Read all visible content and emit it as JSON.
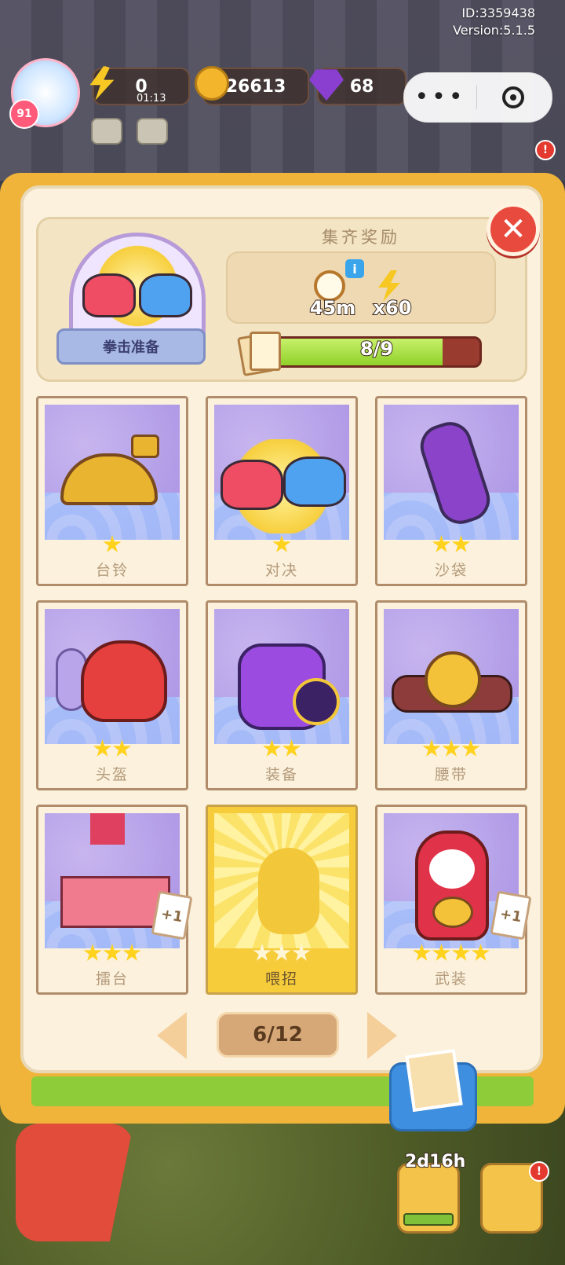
{
  "system": {
    "id_label": "ID:3359438",
    "version_label": "Version:5.1.5"
  },
  "hud": {
    "level": "91",
    "energy": "0",
    "energy_timer": "01:13",
    "coins": "26613",
    "gems": "68",
    "icons": [
      "settings-icon",
      "mail-icon"
    ]
  },
  "capsule": {
    "more_label": "•••",
    "close_icon": "record-icon"
  },
  "album": {
    "set_name": "拳击准备",
    "reward_title": "集齐奖励",
    "rewards": [
      {
        "icon": "clock-icon",
        "value": "45m"
      },
      {
        "icon": "lightning-icon",
        "value": "x60"
      }
    ],
    "progress_label": "8/9",
    "progress_fraction": 0.82,
    "close_icon": "close-icon",
    "info_label": "i"
  },
  "cards": [
    {
      "name": "台铃",
      "stars": 1,
      "max_stars": 1,
      "collected": true,
      "icon": "bell-icon",
      "plus": ""
    },
    {
      "name": "对决",
      "stars": 1,
      "max_stars": 1,
      "collected": true,
      "icon": "gloves-icon",
      "plus": ""
    },
    {
      "name": "沙袋",
      "stars": 2,
      "max_stars": 2,
      "collected": true,
      "icon": "punching-bag-icon",
      "plus": ""
    },
    {
      "name": "头盔",
      "stars": 2,
      "max_stars": 2,
      "collected": true,
      "icon": "helmet-icon",
      "plus": ""
    },
    {
      "name": "装备",
      "stars": 2,
      "max_stars": 2,
      "collected": true,
      "icon": "gym-bag-icon",
      "plus": ""
    },
    {
      "name": "腰带",
      "stars": 3,
      "max_stars": 3,
      "collected": true,
      "icon": "belt-icon",
      "plus": ""
    },
    {
      "name": "擂台",
      "stars": 3,
      "max_stars": 3,
      "collected": true,
      "icon": "boxing-ring-icon",
      "plus": "+1"
    },
    {
      "name": "喂招",
      "stars": 0,
      "max_stars": 3,
      "collected": false,
      "icon": "silhouette-icon",
      "plus": ""
    },
    {
      "name": "武装",
      "stars": 4,
      "max_stars": 4,
      "collected": true,
      "icon": "boxer-duck-icon",
      "plus": "+1"
    }
  ],
  "pagination": {
    "label": "6/12"
  },
  "bottom": {
    "timer": "2d16h"
  },
  "colors": {
    "accent": "#f0b43a",
    "progress": "#8fd12a",
    "close": "#e84a3e",
    "star": "#ffd21e"
  }
}
